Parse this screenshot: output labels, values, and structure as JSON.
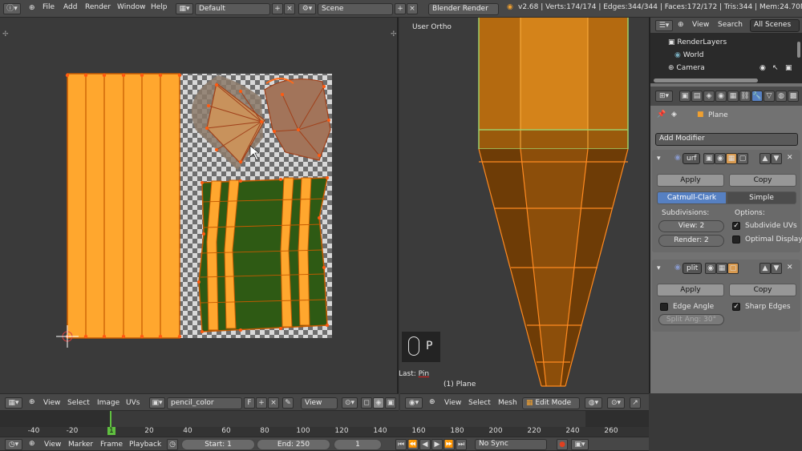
{
  "info_header": {
    "menus": [
      "File",
      "Add",
      "Render",
      "Window",
      "Help"
    ],
    "screen_layout": "Default",
    "scene": "Scene",
    "render_engine": "Blender Render",
    "stats": "v2.68 | Verts:174/174 | Edges:344/344 | Faces:172/172 | Tris:344 | Mem:24.70M (39."
  },
  "uv_editor": {
    "menus": [
      "View",
      "Select",
      "Image",
      "UVs"
    ],
    "image_name": "pencil_color",
    "fake_user": "F",
    "view_label": "View"
  },
  "viewport": {
    "view_name": "User Ortho",
    "key_hint": "P",
    "last_op_prefix": "Last: ",
    "last_op": "Pin",
    "object_label": "(1) Plane",
    "menus": [
      "View",
      "Select",
      "Mesh"
    ],
    "mode": "Edit Mode"
  },
  "outliner": {
    "menus": [
      "View",
      "Search"
    ],
    "filter": "All Scenes",
    "items": [
      "RenderLayers",
      "World",
      "Camera"
    ]
  },
  "properties": {
    "breadcrumb": "Plane",
    "add_modifier": "Add Modifier",
    "mod1": {
      "name": "urf",
      "apply": "Apply",
      "copy": "Copy",
      "tab1": "Catmull-Clark",
      "tab2": "Simple",
      "subdivisions": "Subdivisions:",
      "options": "Options:",
      "view": "View: 2",
      "render": "Render: 2",
      "subdivide_uvs": "Subdivide UVs",
      "optimal_display": "Optimal Display"
    },
    "mod2": {
      "name": "plit",
      "apply": "Apply",
      "copy": "Copy",
      "edge_angle": "Edge Angle",
      "sharp_edges": "Sharp Edges",
      "split_angle": "Split Ang: 30°"
    }
  },
  "timeline": {
    "ticks": [
      "-40",
      "-20",
      "0",
      "20",
      "40",
      "60",
      "80",
      "100",
      "120",
      "140",
      "160",
      "180",
      "200",
      "220",
      "240",
      "260"
    ],
    "current_frame": "1",
    "menus": [
      "View",
      "Marker",
      "Frame",
      "Playback"
    ],
    "start": "Start: 1",
    "end": "End: 250",
    "frame": "1",
    "sync": "No Sync"
  },
  "colors": {
    "accent": "#5680c2",
    "orange": "#ffa72e",
    "uv_green": "#2e5a14",
    "edge_orange": "#ff6a1a"
  }
}
